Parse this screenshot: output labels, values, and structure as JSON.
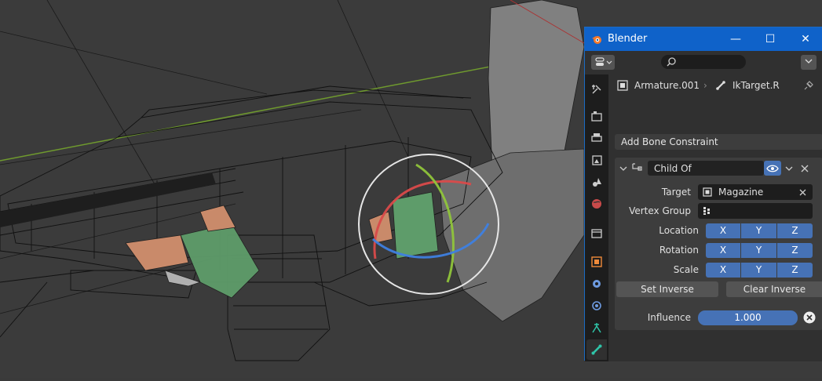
{
  "window": {
    "title": "Blender",
    "minimize": "—",
    "maximize": "☐",
    "close": "✕"
  },
  "breadcrumb": {
    "object": "Armature.001",
    "bone": "IkTarget.R"
  },
  "add_constraint_label": "Add Bone Constraint",
  "constraint": {
    "name": "Child Of",
    "target_label": "Target",
    "target_value": "Magazine",
    "vertex_group_label": "Vertex Group",
    "vertex_group_value": "",
    "location_label": "Location",
    "rotation_label": "Rotation",
    "scale_label": "Scale",
    "axes": [
      "X",
      "Y",
      "Z"
    ],
    "set_inverse": "Set Inverse",
    "clear_inverse": "Clear Inverse",
    "influence_label": "Influence",
    "influence_value": "1.000"
  },
  "tabs": [
    "tool-icon",
    "render-icon",
    "output-icon",
    "view-layer-icon",
    "scene-icon",
    "world-icon",
    "collection-icon",
    "object-icon",
    "modifier-icon",
    "particles-icon",
    "physics-icon",
    "bone-constraint-icon",
    "bone-icon"
  ],
  "colors": {
    "accent": "#4672b6",
    "titlebar": "#0f62c9",
    "panel": "#303030"
  }
}
